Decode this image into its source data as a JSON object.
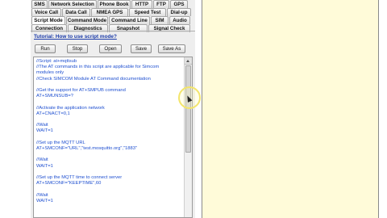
{
  "tabs": {
    "row1": [
      "SMS",
      "Network Selection",
      "Phone Book",
      "HTTP",
      "FTP",
      "GPS"
    ],
    "row2": [
      "Voice Call",
      "Data Call",
      "NMEA GPS",
      "Speed Test",
      "Dial-up"
    ],
    "row3": [
      "Script Mode",
      "Command Mode",
      "Command Line",
      "SIM",
      "Audio"
    ],
    "row4": [
      "Connection",
      "Diagnostics",
      "Snapshot",
      "Signal Check"
    ],
    "active": "Script Mode"
  },
  "tutorial_link": "Tutorial: How to use script mode?",
  "toolbar": {
    "run": "Run",
    "stop": "Stop",
    "open": "Open",
    "save": "Save",
    "save_as": "Save As"
  },
  "script_lines": [
    "//Script: at+mqttsub",
    "//The AT commands in this script are applicable for Simcom",
    "modules only",
    "//Check SIMCOM Module AT Command documentation",
    "",
    "//Get the support for AT+SMPUB command",
    "AT+SMUNSUB=?",
    "",
    "//Activate the application network",
    "AT+CNACT=0,1",
    "",
    "//Wait",
    "WAIT=1",
    "",
    "//Set up the MQTT URL",
    "AT+SMCONF=\"URL\",\"test.mosquitto.org\",\"1883\"",
    "",
    "//Wait",
    "WAIT=1",
    "",
    "//Set up the MQTT time to connect server",
    "AT+SMCONF=\"KEEPTIME\",60",
    "",
    "//Wait",
    "WAIT=1"
  ],
  "colors": {
    "script_text": "#1e4fd0",
    "link": "#1a3aa8",
    "output_panel": "#fffbd9",
    "cursor_highlight": "#f3e56c"
  }
}
